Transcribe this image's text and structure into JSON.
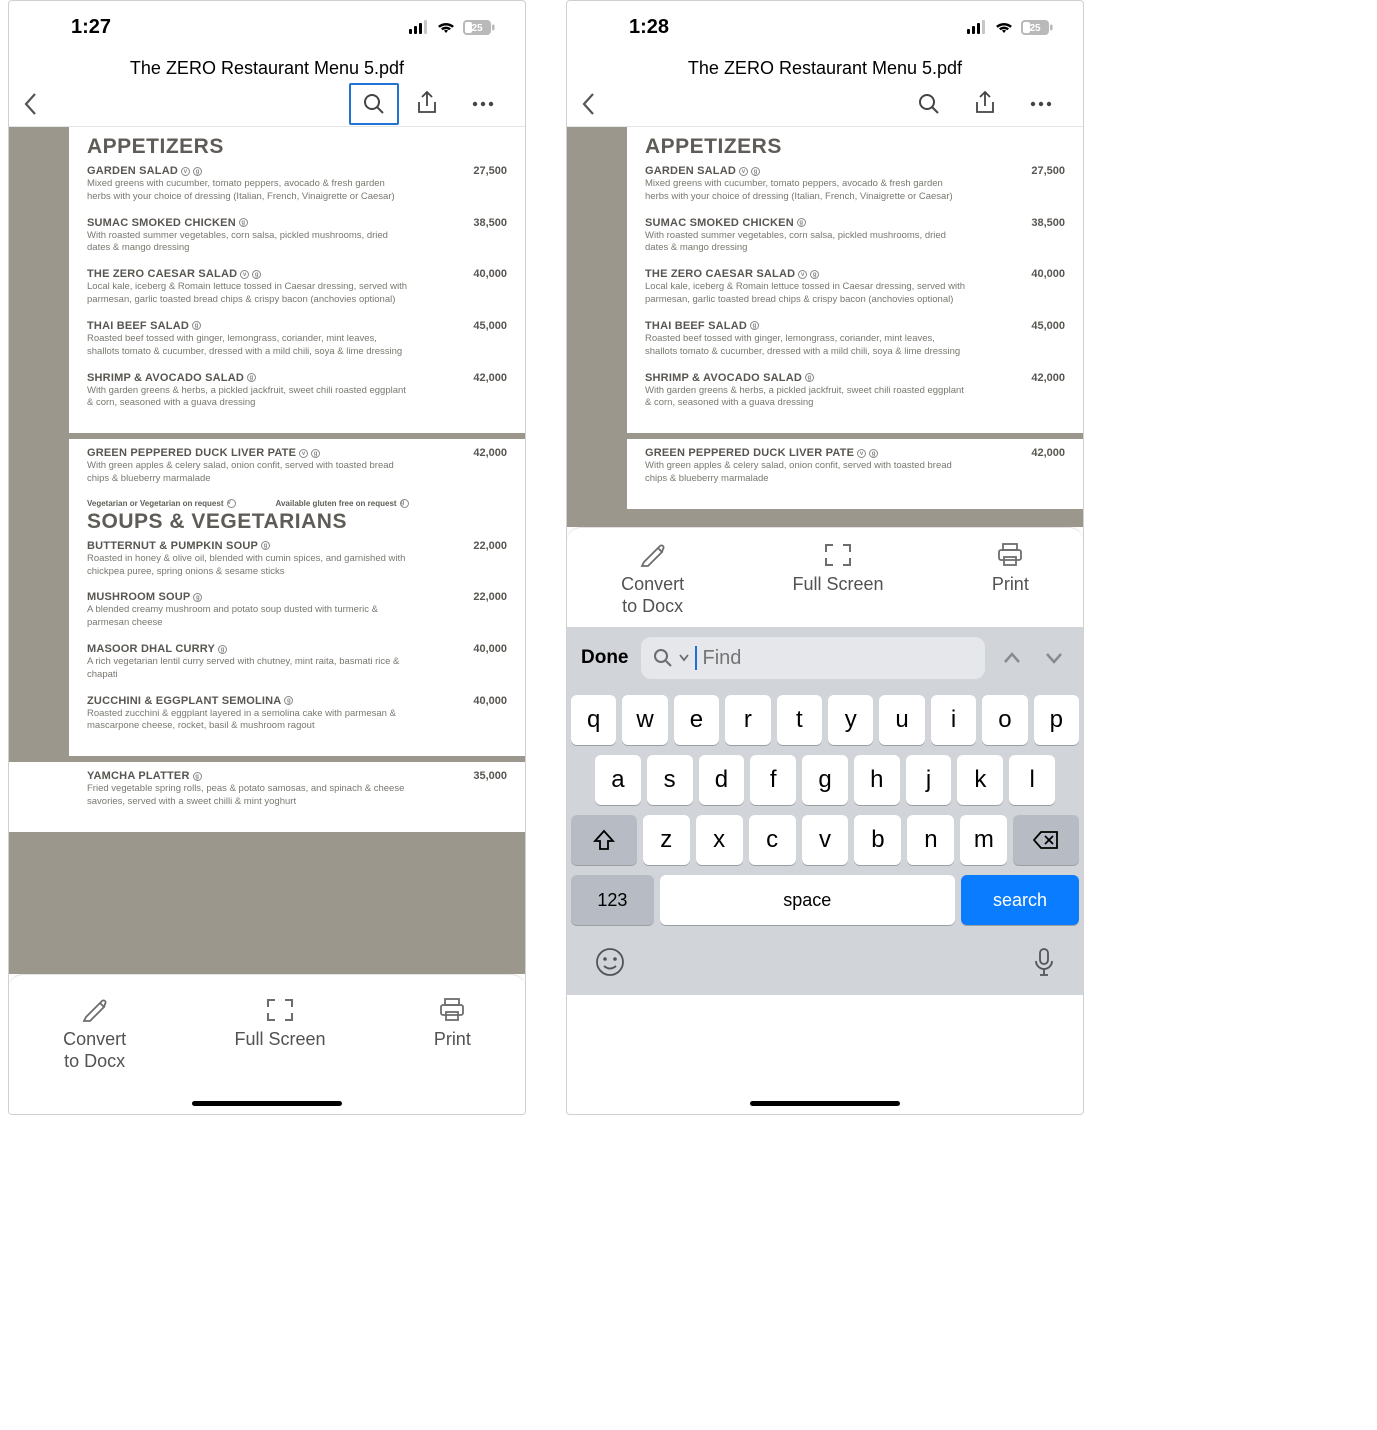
{
  "status": {
    "time_left": "1:27",
    "time_right": "1:28",
    "battery": "25"
  },
  "nav": {
    "title": "The ZERO Restaurant Menu 5.pdf"
  },
  "sections": {
    "appetizers_title": "APPETIZERS",
    "soups_title": "SOUPS & VEGETARIANS"
  },
  "notes": {
    "veg": "Vegetarian or Vegetarian on request",
    "gf": "Available gluten free on request"
  },
  "items": {
    "garden_salad": {
      "name": "GARDEN SALAD",
      "desc": "Mixed greens with cucumber, tomato peppers, avocado & fresh garden herbs with your choice of dressing (Italian, French, Vinaigrette or Caesar)",
      "price": "27,500"
    },
    "sumac_chicken": {
      "name": "SUMAC SMOKED CHICKEN",
      "desc": "With roasted summer vegetables, corn salsa, pickled mushrooms, dried dates & mango dressing",
      "price": "38,500"
    },
    "zero_caesar": {
      "name": "THE ZERO CAESAR SALAD",
      "desc": "Local kale, iceberg & Romain lettuce tossed in Caesar dressing, served with parmesan, garlic toasted bread chips & crispy bacon (anchovies optional)",
      "price": "40,000"
    },
    "thai_beef": {
      "name": "THAI BEEF SALAD",
      "desc": "Roasted beef tossed with ginger, lemongrass, coriander, mint leaves, shallots tomato & cucumber, dressed with a mild chili, soya & lime dressing",
      "price": "45,000"
    },
    "shrimp_avocado": {
      "name": "SHRIMP & AVOCADO SALAD",
      "desc": "With garden greens & herbs, a pickled jackfruit, sweet chili roasted eggplant & corn, seasoned with a guava dressing",
      "price": "42,000"
    },
    "duck_liver": {
      "name": "GREEN PEPPERED DUCK LIVER PATE",
      "desc": "With green apples & celery salad, onion confit, served with toasted bread chips & blueberry marmalade",
      "price": "42,000"
    },
    "butternut": {
      "name": "BUTTERNUT & PUMPKIN SOUP",
      "desc": "Roasted in honey & olive oil, blended with cumin spices, and garnished with chickpea puree, spring onions & sesame sticks",
      "price": "22,000"
    },
    "mushroom": {
      "name": "MUSHROOM SOUP",
      "desc": "A blended creamy mushroom and potato soup dusted with turmeric & parmesan cheese",
      "price": "22,000"
    },
    "masoor": {
      "name": "MASOOR DHAL CURRY",
      "desc": "A rich vegetarian lentil curry served with chutney, mint raita, basmati rice & chapati",
      "price": "40,000"
    },
    "zucchini": {
      "name": "ZUCCHINI & EGGPLANT SEMOLINA",
      "desc": "Roasted zucchini & eggplant layered in a semolina cake with parmesan & mascarpone cheese, rocket, basil & mushroom ragout",
      "price": "40,000"
    },
    "yamcha": {
      "name": "YAMCHA PLATTER",
      "desc": "Fried vegetable spring rolls, peas & potato samosas, and spinach & cheese savories, served with a sweet chilli & mint yoghurt",
      "price": "35,000"
    }
  },
  "bottom": {
    "convert": "Convert to Docx",
    "fullscreen": "Full Screen",
    "print": "Print"
  },
  "search": {
    "done": "Done",
    "placeholder": "Find"
  },
  "keyboard": {
    "row1": [
      "q",
      "w",
      "e",
      "r",
      "t",
      "y",
      "u",
      "i",
      "o",
      "p"
    ],
    "row2": [
      "a",
      "s",
      "d",
      "f",
      "g",
      "h",
      "j",
      "k",
      "l"
    ],
    "row3": [
      "z",
      "x",
      "c",
      "v",
      "b",
      "n",
      "m"
    ],
    "num": "123",
    "space": "space",
    "search": "search"
  }
}
